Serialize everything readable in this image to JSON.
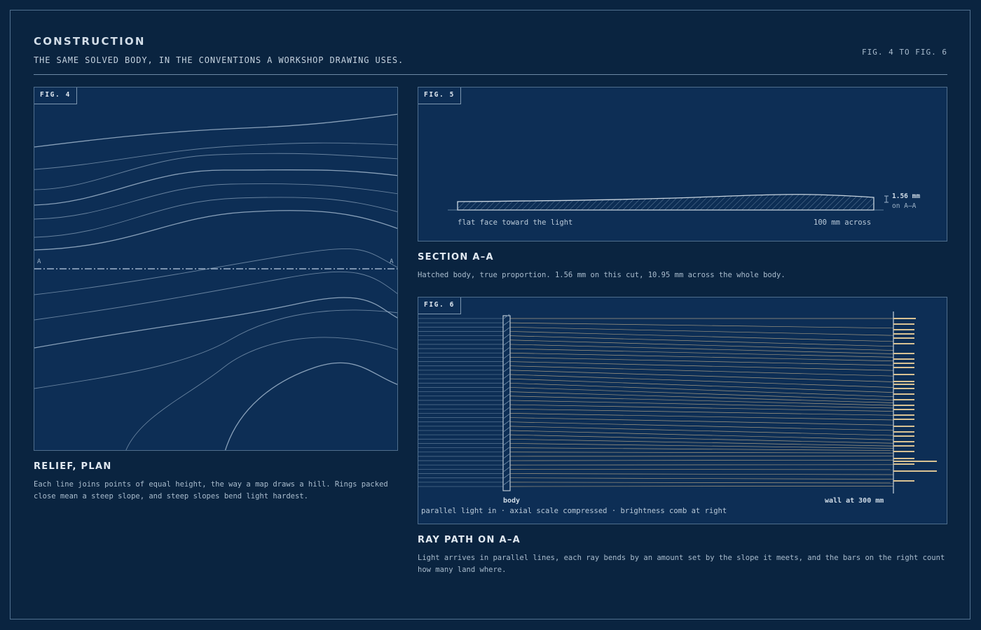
{
  "header": {
    "title": "CONSTRUCTION",
    "subtitle": "THE SAME SOLVED BODY, IN THE CONVENTIONS A WORKSHOP DRAWING USES.",
    "fig_range": "FIG. 4 TO FIG. 6"
  },
  "colors": {
    "background": "#0a2440",
    "panel": "#0d2e55",
    "line": "#8fa6bf",
    "accent_ray": "#c9b48c"
  },
  "fig4": {
    "tag": "FIG. 4",
    "section_mark_left": "A",
    "section_mark_right": "A",
    "title": "RELIEF, PLAN",
    "text": "Each line joins points of equal height, the way a map draws a hill. Rings packed close mean a steep slope, and steep slopes bend light hardest."
  },
  "fig5": {
    "tag": "FIG. 5",
    "thickness_value": "1.56 mm",
    "thickness_cut": "on A–A",
    "left_label": "flat face toward the light",
    "right_label": "100 mm across",
    "title": "SECTION A–A",
    "text": "Hatched body, true proportion. 1.56 mm on this cut, 10.95 mm across the whole body."
  },
  "fig6": {
    "tag": "FIG. 6",
    "body_label": "body",
    "wall_label": "wall at 300 mm",
    "footer_label": "parallel light in · axial scale compressed · brightness comb at right",
    "title": "RAY PATH ON A–A",
    "text": "Light arrives in parallel lines, each ray bends by an amount set by the slope it meets, and the bars on the right count how many land where."
  }
}
